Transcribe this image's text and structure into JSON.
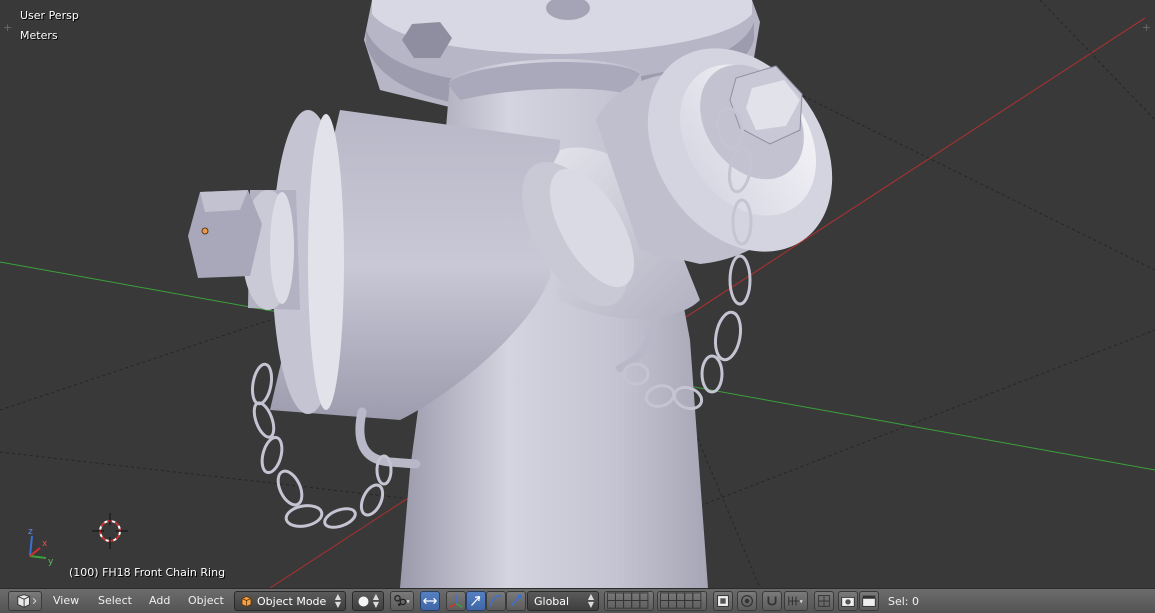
{
  "viewport": {
    "view_label": "User Persp",
    "units_label": "Meters",
    "object_info": "(100) FH18 Front Chain Ring",
    "colors": {
      "background": "#393939",
      "grid_x_axis": "#b03030",
      "grid_y_axis": "#3aa13a",
      "object_body": "#c8c8d6",
      "object_shadow": "#8c8c9c",
      "object_highlight": "#eeeef4"
    },
    "icons": [
      "3d-cursor-icon",
      "axis-gizmo-icon"
    ],
    "gizmo_axes": [
      "z",
      "y",
      "x"
    ]
  },
  "header": {
    "editor_type_icon": "3d-view-cube-icon",
    "menus": [
      "View",
      "Select",
      "Add",
      "Object"
    ],
    "mode": {
      "icon": "object-cube-icon",
      "label": "Object Mode"
    },
    "shading_icon": "solid-sphere-icon",
    "pivot_icon": "pivot-median-icon",
    "manipulator_toggle_icon": "manipulator-arrows-icon",
    "transform_orientation": "Global",
    "layers_icon": "layer-grid-icon",
    "status": "Sel: 0",
    "accent": "#5680c2"
  }
}
